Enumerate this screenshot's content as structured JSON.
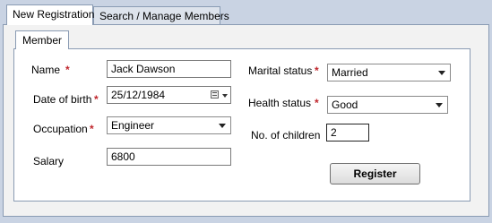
{
  "tabs": [
    {
      "label": "New Registration"
    },
    {
      "label": "Search / Manage Members"
    }
  ],
  "group": {
    "title": "Member"
  },
  "required_marker": "*",
  "form": {
    "name": {
      "label": "Name",
      "value": "Jack Dawson"
    },
    "dob": {
      "label": "Date of birth",
      "value": "25/12/1984"
    },
    "occupation": {
      "label": "Occupation",
      "value": "Engineer"
    },
    "salary": {
      "label": "Salary",
      "value": "6800"
    },
    "marital": {
      "label": "Marital status",
      "value": "Married"
    },
    "health": {
      "label": "Health status",
      "value": "Good"
    },
    "children": {
      "label": "No. of children",
      "value": "2"
    }
  },
  "register_button": {
    "label": "Register"
  },
  "colors": {
    "background": "#c9d3e3",
    "required": "#c0262c"
  }
}
